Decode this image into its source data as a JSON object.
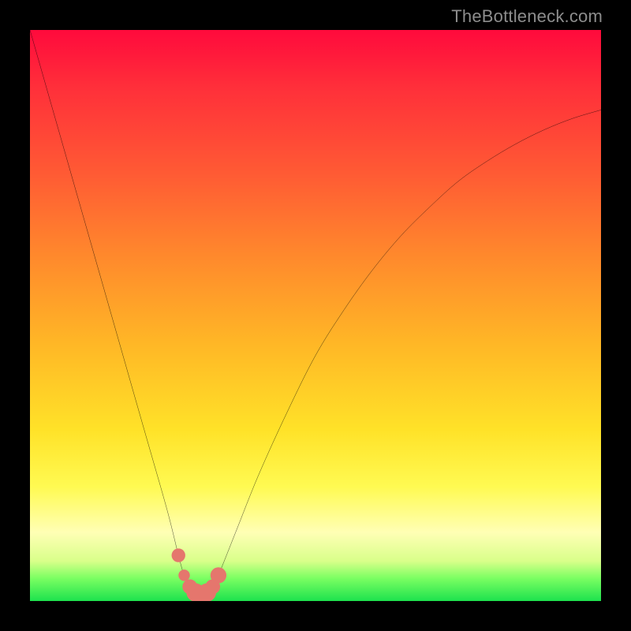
{
  "attribution": "TheBottleneck.com",
  "chart_data": {
    "type": "line",
    "title": "",
    "xlabel": "",
    "ylabel": "",
    "xlim": [
      0,
      100
    ],
    "ylim": [
      0,
      100
    ],
    "grid": false,
    "series": [
      {
        "name": "bottleneck-curve",
        "x": [
          0,
          4,
          8,
          12,
          16,
          20,
          24,
          26,
          27,
          28,
          29,
          30,
          31,
          32,
          33,
          36,
          40,
          45,
          50,
          55,
          60,
          65,
          70,
          75,
          80,
          85,
          90,
          95,
          100
        ],
        "values": [
          100,
          86,
          72,
          58,
          44,
          30,
          16,
          8,
          4.5,
          2.5,
          1.5,
          1,
          1.5,
          2.5,
          4.5,
          12,
          22,
          33,
          43,
          51,
          58,
          64,
          69,
          73.5,
          77,
          80,
          82.5,
          84.5,
          86
        ]
      }
    ],
    "markers": {
      "name": "lowpoint-markers",
      "color": "#e5766d",
      "x": [
        26,
        27,
        28,
        29,
        30,
        31,
        32,
        33
      ],
      "values": [
        8,
        4.5,
        2.5,
        1.5,
        1,
        1.5,
        2.5,
        4.5
      ],
      "radius": [
        1.2,
        1.0,
        1.3,
        1.6,
        1.6,
        1.6,
        1.3,
        1.4
      ]
    }
  }
}
